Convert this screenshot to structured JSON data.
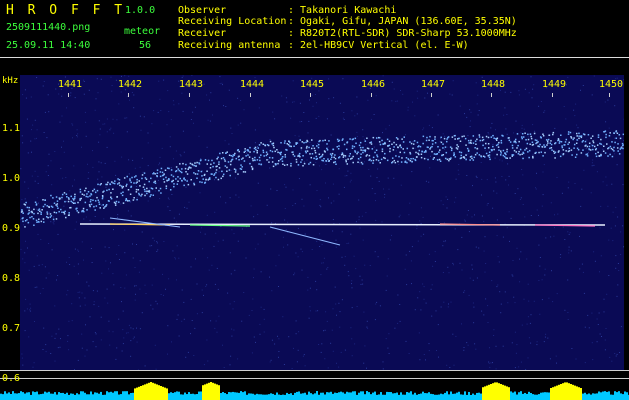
{
  "header": {
    "app_name": "H R O F F T",
    "version": "1.0.0",
    "filename": "2509111440.png",
    "datetime": "25.09.11 14:40",
    "meteor_label": "meteor",
    "meteor_count": "56"
  },
  "info": [
    {
      "label": "Observer",
      "value": ": Takanori Kawachi"
    },
    {
      "label": "Receiving Location",
      "value": ": Ogaki, Gifu, JAPAN (136.60E, 35.35N)"
    },
    {
      "label": "Receiver",
      "value": ": R820T2(RTL-SDR) SDR-Sharp 53.1000MHz"
    },
    {
      "label": "Receiving antenna",
      "value": ": 2el-HB9CV Vertical (el. E-W)"
    }
  ],
  "axes": {
    "y_unit": "kHz",
    "x_ticks": [
      "1441",
      "1442",
      "1443",
      "1444",
      "1445",
      "1446",
      "1447",
      "1448",
      "1449",
      "1450"
    ],
    "y_ticks": [
      "1.1",
      "1.0",
      "0.9",
      "0.8",
      "0.7",
      "0.6"
    ]
  },
  "colors": {
    "background": "#000000",
    "plot_bg": "#0a0a55",
    "text_yellow": "#ffff00",
    "text_green": "#3cff3c",
    "signal": "#6fb0ff",
    "carrier": "#e8f0ff",
    "level_bar": "#00c8ff",
    "level_peak": "#ffff00"
  }
}
